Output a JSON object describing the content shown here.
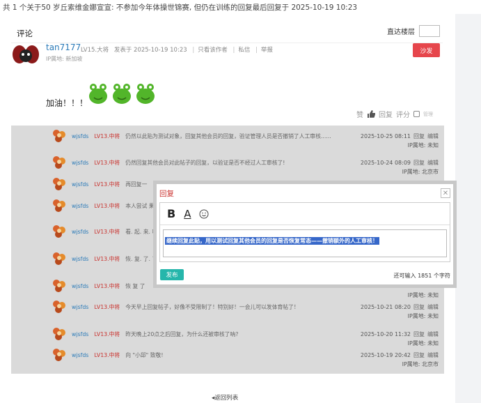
{
  "topic": {
    "title": "共 1 个关于50 岁丘索维金娜宣宣: 不参加今年体操世锦赛, 但仍在训练的回复最后回复于 2025-10-19 10:23"
  },
  "comments_header": {
    "title": "评论",
    "jump_label": "直达楼层",
    "jump_value": ""
  },
  "post": {
    "author": "tan7177",
    "level": "LV15.大将",
    "posted_at": "发表于 2025-10-19 10:23",
    "only_author": "只看该作者",
    "private_msg": "私信",
    "report": "举报",
    "ip": "IP属地: 新加坡",
    "sofa_label": "沙发",
    "content": "加油！！！",
    "actions": {
      "like": "赞",
      "reply": "回复",
      "rate": "评分",
      "admin": "管理"
    }
  },
  "replies": [
    {
      "name": "wjsfds",
      "level": "LV13.中将",
      "text": "仍然以此贴为测试对象，回复其他会员的回复，验证管理人员是否撤销了人工审核......",
      "date": "2025-10-25 08:11",
      "reply": "回复",
      "edit": "编辑",
      "ip": "IP属地: 未知"
    },
    {
      "name": "wjsfds",
      "level": "LV13.中将",
      "text": "仍然回复其他会员对此帖子的回复，以验证是否不经过人工审核了!",
      "date": "2025-10-24 08:09",
      "reply": "回复",
      "edit": "编辑",
      "ip": "IP属地: 北京市"
    },
    {
      "name": "wjsfds",
      "level": "LV13.中将",
      "text": "再回复一",
      "date": "",
      "reply": "",
      "edit": "",
      "ip": ""
    },
    {
      "name": "wjsfds",
      "level": "LV13.中将",
      "text": "本人尝试 果仍然要经过人工审核才能够显",
      "date": "",
      "reply": "",
      "edit": "",
      "ip": ""
    },
    {
      "name": "wjsfds",
      "level": "LV13.中将",
      "text": "看. 起. 来. 吗. ? !",
      "date": "",
      "reply": "",
      "edit": "",
      "ip": ""
    },
    {
      "name": "wjsfds",
      "level": "LV13.中将",
      "text": "恢. 复. 了. 了. 吗. ? !",
      "date": "",
      "reply": "",
      "edit": "",
      "ip": ""
    },
    {
      "name": "wjsfds",
      "level": "LV13.中将",
      "text": "恢 复 了",
      "date": "",
      "reply": "",
      "edit": "",
      "ip": "IP属地: 未知"
    },
    {
      "name": "wjsfds",
      "level": "LV13.中将",
      "text": "今天早上回复帖子，好像不受限制了！特别好！一会儿可以发体育帖了！",
      "date": "2025-10-21 08:20",
      "reply": "回复",
      "edit": "编辑",
      "ip": "IP属地: 未知"
    },
    {
      "name": "wjsfds",
      "level": "LV13.中将",
      "text": "昨天晚上20点之后回复，为什么还被审核了呐?",
      "date": "2025-10-20 11:32",
      "reply": "回复",
      "edit": "编辑",
      "ip": "IP属地: 未知"
    },
    {
      "name": "wjsfds",
      "level": "LV13.中将",
      "text": "向 \"小邱\" 致敬!",
      "date": "2025-10-19 20:42",
      "reply": "回复",
      "edit": "编辑",
      "ip": "IP属地: 北京市"
    }
  ],
  "dialog": {
    "title": "回复",
    "close_icon": "close-icon",
    "toolbar": {
      "bold": "B",
      "font": "A"
    },
    "selected_text": "继续回复此贴，用以测试回复其他会员的回复是否恢复常态——撤销额外的人工审核！",
    "publish_label": "发布",
    "counter": "还可输入 1851 个字符"
  },
  "back_label": "◂返回列表",
  "colors": {
    "accent_red": "#e6464c",
    "link_blue": "#2a7ab8",
    "publish_teal": "#26b6ab",
    "level_red": "#c9302c"
  }
}
